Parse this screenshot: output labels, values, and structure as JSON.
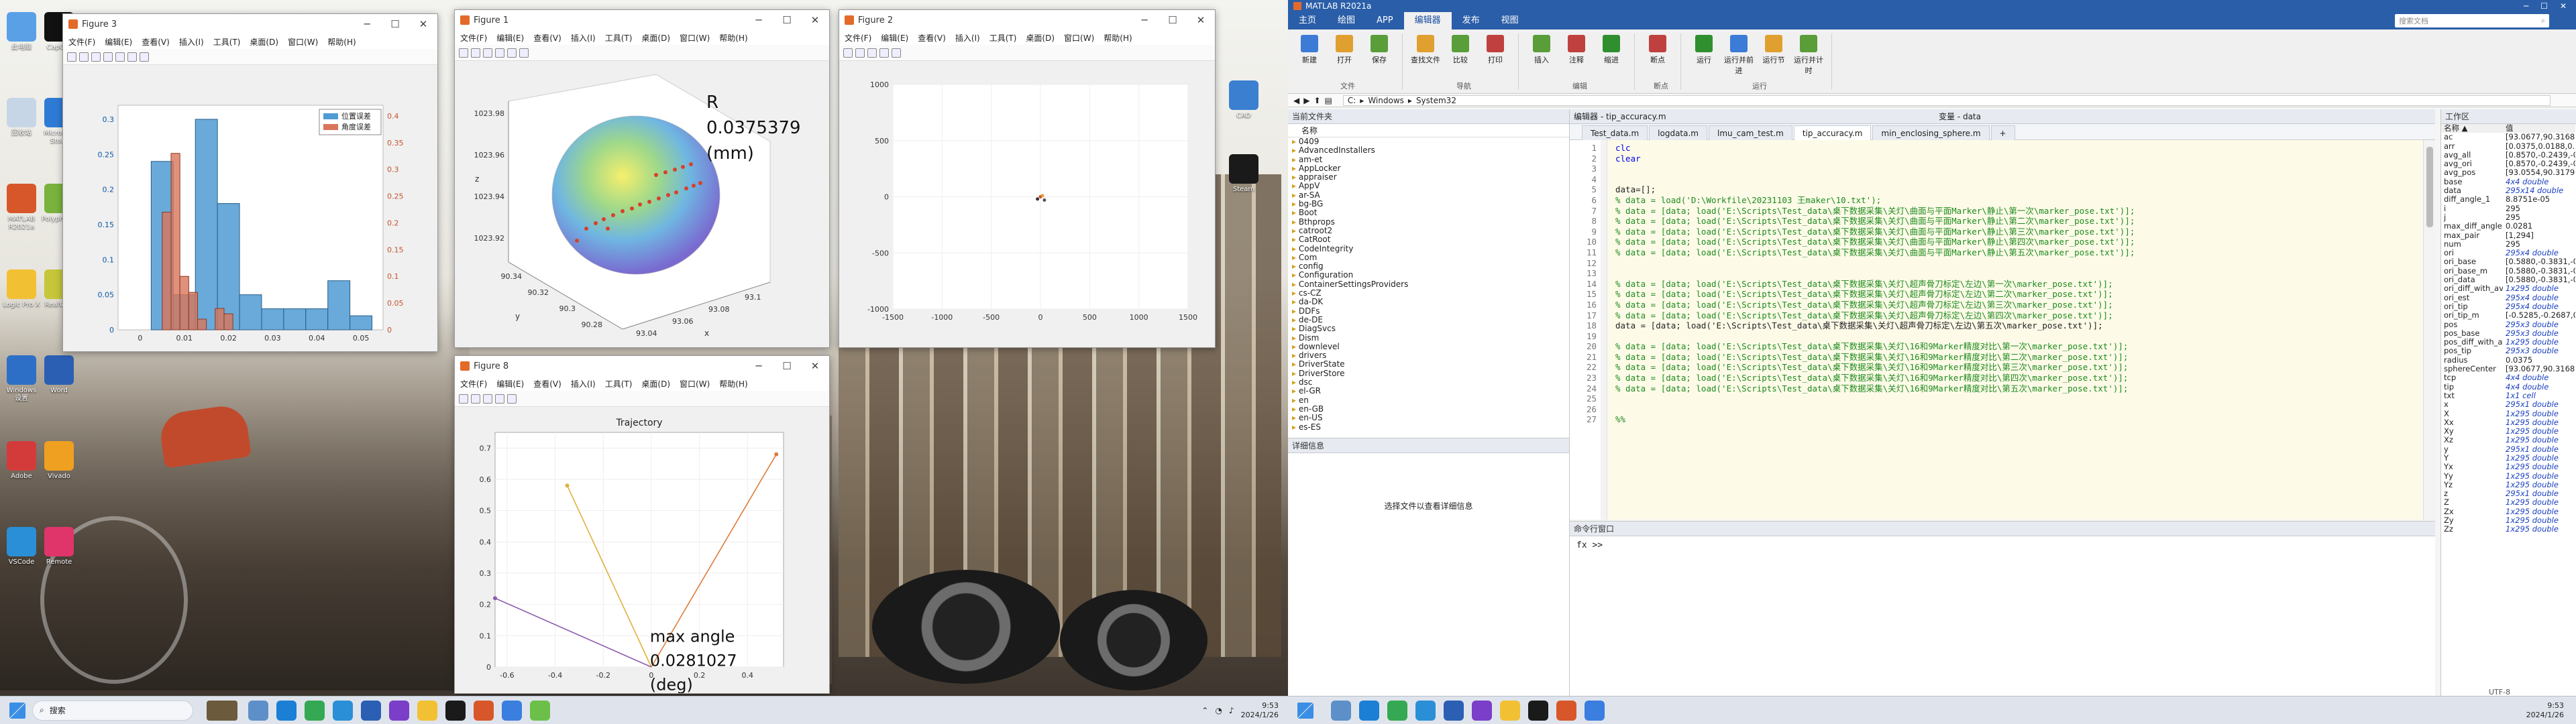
{
  "desktop": {
    "icons": [
      {
        "label": "此电脑",
        "color": "#5aa0e6"
      },
      {
        "label": "回收站",
        "color": "#c6d6e6"
      },
      {
        "label": "MATLAB R2021a",
        "color": "#d8572a"
      },
      {
        "label": "Logic Pro X",
        "color": "#f2c033"
      },
      {
        "label": "Windows 设置",
        "color": "#2d6fc7"
      },
      {
        "label": "Adobe",
        "color": "#d33b3b"
      },
      {
        "label": "VSCode",
        "color": "#2a8fd6"
      },
      {
        "label": "CapCut",
        "color": "#111111"
      },
      {
        "label": "Microsoft Store",
        "color": "#2e7bd6"
      },
      {
        "label": "Polyphone",
        "color": "#79b33d"
      },
      {
        "label": "RealVNC",
        "color": "#c6c63a"
      },
      {
        "label": "Word",
        "color": "#2b5fb4"
      },
      {
        "label": "Vivado",
        "color": "#f0a020"
      },
      {
        "label": "Remote",
        "color": "#e0356b"
      }
    ]
  },
  "taskbar": {
    "search": "搜索",
    "time": "9:53",
    "date": "2024/1/26",
    "time2": "9:53",
    "date2": "2024/1/26"
  },
  "fig3": {
    "title": "Figure 3",
    "menu": [
      "文件(F)",
      "编辑(E)",
      "查看(V)",
      "插入(I)",
      "工具(T)",
      "桌面(D)",
      "窗口(W)",
      "帮助(H)"
    ],
    "legend": [
      "位置误差",
      "角度误差"
    ],
    "legend_colors": [
      "#4f9bd4",
      "#d9765a"
    ],
    "chart_data": {
      "type": "bar",
      "x_ticks": [
        "0",
        "0.01",
        "0.02",
        "0.03",
        "0.04",
        "0.05"
      ],
      "y_left_ticks": [
        "0",
        "0.05",
        "0.1",
        "0.15",
        "0.2",
        "0.25",
        "0.3"
      ],
      "y_right_ticks": [
        "0",
        "0.05",
        "0.1",
        "0.15",
        "0.2",
        "0.25",
        "0.3",
        "0.35",
        "0.4"
      ],
      "series": [
        {
          "name": "位置误差",
          "bins": [
            [
              0.0025,
              0.0075,
              0.24
            ],
            [
              0.0075,
              0.0125,
              0.05
            ],
            [
              0.0125,
              0.0175,
              0.3
            ],
            [
              0.0175,
              0.0225,
              0.18
            ],
            [
              0.0225,
              0.0275,
              0.05
            ],
            [
              0.0275,
              0.0325,
              0.03
            ],
            [
              0.0325,
              0.0375,
              0.03
            ],
            [
              0.0375,
              0.0425,
              0.03
            ],
            [
              0.0425,
              0.0475,
              0.07
            ],
            [
              0.0475,
              0.0525,
              0.02
            ]
          ]
        },
        {
          "name": "角度误差",
          "bins": [
            [
              0.005,
              0.007,
              0.22
            ],
            [
              0.007,
              0.009,
              0.33
            ],
            [
              0.009,
              0.011,
              0.1
            ],
            [
              0.011,
              0.013,
              0.07
            ],
            [
              0.013,
              0.015,
              0.02
            ],
            [
              0.017,
              0.019,
              0.04
            ],
            [
              0.019,
              0.021,
              0.03
            ]
          ]
        }
      ]
    }
  },
  "fig1": {
    "title": "Figure 1",
    "menu": [
      "文件(F)",
      "编辑(E)",
      "查看(V)",
      "插入(I)",
      "工具(T)",
      "桌面(D)",
      "窗口(W)",
      "帮助(H)"
    ],
    "annot": [
      "R",
      "0.0375379",
      "(mm)"
    ],
    "chart_data": {
      "type": "scatter",
      "z_ticks": [
        "1023.92",
        "1023.94",
        "1023.96",
        "1023.98"
      ],
      "y_ticks": [
        "90.34",
        "90.32",
        "90.3",
        "90.28"
      ],
      "x_ticks": [
        "93.04",
        "93.06",
        "93.08",
        "93.1"
      ],
      "zlabel": "z",
      "ylabel": "y",
      "xlabel": "x"
    }
  },
  "fig2": {
    "title": "Figure 2",
    "menu": [
      "文件(F)",
      "编辑(E)",
      "查看(V)",
      "插入(I)",
      "工具(T)",
      "桌面(D)",
      "窗口(W)",
      "帮助(H)"
    ],
    "chart_data": {
      "type": "scatter",
      "x_ticks": [
        "-1500",
        "-1000",
        "-500",
        "0",
        "500",
        "1000",
        "1500"
      ],
      "y_ticks": [
        "1000",
        "500",
        "0",
        "-500",
        "-1000"
      ],
      "xlim": [
        -1500,
        1500
      ],
      "ylim": [
        -1000,
        1000
      ]
    }
  },
  "fig8": {
    "title": "Figure 8",
    "menu": [
      "文件(F)",
      "编辑(E)",
      "查看(V)",
      "插入(I)",
      "工具(T)",
      "桌面(D)",
      "窗口(W)",
      "帮助(H)"
    ],
    "annot": [
      "max angle",
      "0.0281027",
      "(deg)"
    ],
    "chart_data": {
      "type": "line",
      "title": "Trajectory",
      "x_ticks": [
        "-0.6",
        "-0.4",
        "-0.2",
        "0",
        "0.2",
        "0.4"
      ],
      "y_ticks": [
        "0",
        "0.1",
        "0.2",
        "0.3",
        "0.4",
        "0.5",
        "0.6",
        "0.7"
      ],
      "xlim": [
        -0.65,
        0.55
      ],
      "ylim": [
        0,
        0.75
      ],
      "series": [
        {
          "x": [
            0,
            0.52
          ],
          "y": [
            0,
            0.68
          ],
          "color": "#e07b3a"
        },
        {
          "x": [
            0,
            -0.35
          ],
          "y": [
            0,
            0.58
          ],
          "color": "#e0b040"
        },
        {
          "x": [
            0,
            -0.65
          ],
          "y": [
            0,
            0.22
          ],
          "color": "#8e5cae"
        }
      ]
    }
  },
  "matlab": {
    "title": "MATLAB R2021a",
    "tabs": [
      "主页",
      "绘图",
      "APP",
      "编辑器",
      "发布",
      "视图"
    ],
    "search_placeholder": "搜索文档",
    "ribbon_groups": [
      {
        "label": "文件",
        "buttons": [
          "新建",
          "打开",
          "保存"
        ]
      },
      {
        "label": "导航",
        "buttons": [
          "查找文件",
          "比较",
          "打印"
        ]
      },
      {
        "label": "编辑",
        "buttons": [
          "插入",
          "注释",
          "缩进"
        ]
      },
      {
        "label": "断点",
        "buttons": [
          "断点"
        ]
      },
      {
        "label": "运行",
        "buttons": [
          "运行",
          "运行并前进",
          "运行节",
          "运行并计时"
        ]
      }
    ],
    "path": [
      "C:",
      "Windows",
      "System32"
    ],
    "current_folder_title": "当前文件夹",
    "folder_col": "名称",
    "folders": [
      "0409",
      "AdvancedInstallers",
      "am-et",
      "AppLocker",
      "appraiser",
      "AppV",
      "ar-SA",
      "bg-BG",
      "Boot",
      "Bthprops",
      "catroot2",
      "CatRoot",
      "CodeIntegrity",
      "Com",
      "config",
      "Configuration",
      "ContainerSettingsProviders",
      "cs-CZ",
      "da-DK",
      "DDFs",
      "de-DE",
      "DiagSvcs",
      "Dism",
      "downlevel",
      "drivers",
      "DriverState",
      "DriverStore",
      "dsc",
      "el-GR",
      "en",
      "en-GB",
      "en-US",
      "es-ES"
    ],
    "details_title": "详细信息",
    "details_msg": "选择文件以查看详细信息",
    "editor_title": "编辑器 - tip_accuracy.m",
    "var_title": "变量 - data",
    "editor_tabs": [
      "Test_data.m",
      "logdata.m",
      "lmu_cam_test.m",
      "tip_accuracy.m",
      "min_enclosing_sphere.m"
    ],
    "active_tab": "tip_accuracy.m",
    "code": [
      {
        "t": "kw",
        "s": "clc"
      },
      {
        "t": "kw",
        "s": "clear"
      },
      {
        "t": "",
        "s": ""
      },
      {
        "t": "",
        "s": ""
      },
      {
        "t": "",
        "s": "data=[];"
      },
      {
        "t": "cm",
        "s": "% data = load('D:\\Workfile\\20231103 王maker\\10.txt');"
      },
      {
        "t": "cm",
        "s": "% data = [data; load('E:\\Scripts\\Test_data\\桌下数据采集\\关灯\\曲面与平面Marker\\静止\\第一次\\marker_pose.txt')];"
      },
      {
        "t": "cm",
        "s": "% data = [data; load('E:\\Scripts\\Test_data\\桌下数据采集\\关灯\\曲面与平面Marker\\静止\\第二次\\marker_pose.txt')];"
      },
      {
        "t": "cm",
        "s": "% data = [data; load('E:\\Scripts\\Test_data\\桌下数据采集\\关灯\\曲面与平面Marker\\静止\\第三次\\marker_pose.txt')];"
      },
      {
        "t": "cm",
        "s": "% data = [data; load('E:\\Scripts\\Test_data\\桌下数据采集\\关灯\\曲面与平面Marker\\静止\\第四次\\marker_pose.txt')];"
      },
      {
        "t": "cm",
        "s": "% data = [data; load('E:\\Scripts\\Test_data\\桌下数据采集\\关灯\\曲面与平面Marker\\静止\\第五次\\marker_pose.txt')];"
      },
      {
        "t": "",
        "s": ""
      },
      {
        "t": "",
        "s": ""
      },
      {
        "t": "cm",
        "s": "% data = [data; load('E:\\Scripts\\Test_data\\桌下数据采集\\关灯\\超声骨刀标定\\左边\\第一次\\marker_pose.txt')];"
      },
      {
        "t": "cm",
        "s": "% data = [data; load('E:\\Scripts\\Test_data\\桌下数据采集\\关灯\\超声骨刀标定\\左边\\第二次\\marker_pose.txt')];"
      },
      {
        "t": "cm",
        "s": "% data = [data; load('E:\\Scripts\\Test_data\\桌下数据采集\\关灯\\超声骨刀标定\\左边\\第三次\\marker_pose.txt')];"
      },
      {
        "t": "cm",
        "s": "% data = [data; load('E:\\Scripts\\Test_data\\桌下数据采集\\关灯\\超声骨刀标定\\左边\\第四次\\marker_pose.txt')];"
      },
      {
        "t": "",
        "s": "data = [data; load('E:\\Scripts\\Test_data\\桌下数据采集\\关灯\\超声骨刀标定\\左边\\第五次\\marker_pose.txt')];"
      },
      {
        "t": "",
        "s": ""
      },
      {
        "t": "cm",
        "s": "% data = [data; load('E:\\Scripts\\Test_data\\桌下数据采集\\关灯\\16和9Marker精度对比\\第一次\\marker_pose.txt')];"
      },
      {
        "t": "cm",
        "s": "% data = [data; load('E:\\Scripts\\Test_data\\桌下数据采集\\关灯\\16和9Marker精度对比\\第二次\\marker_pose.txt')];"
      },
      {
        "t": "cm",
        "s": "% data = [data; load('E:\\Scripts\\Test_data\\桌下数据采集\\关灯\\16和9Marker精度对比\\第三次\\marker_pose.txt')];"
      },
      {
        "t": "cm",
        "s": "% data = [data; load('E:\\Scripts\\Test_data\\桌下数据采集\\关灯\\16和9Marker精度对比\\第四次\\marker_pose.txt')];"
      },
      {
        "t": "cm",
        "s": "% data = [data; load('E:\\Scripts\\Test_data\\桌下数据采集\\关灯\\16和9Marker精度对比\\第五次\\marker_pose.txt')];"
      },
      {
        "t": "",
        "s": ""
      },
      {
        "t": "",
        "s": ""
      },
      {
        "t": "cm",
        "s": "%%"
      }
    ],
    "cmd_title": "命令行窗口",
    "cmd_prompt": "fx >>",
    "ws_title": "工作区",
    "ws_cols": [
      "名称 ▲",
      "值"
    ],
    "ws": [
      [
        "ac",
        "[93.0677,90.3168,1...",
        "n"
      ],
      [
        "arr",
        "[0.0375,0.0188,0.00...",
        "n"
      ],
      [
        "avg_all",
        "[0.8570,-0.2439,-0.3...",
        "n"
      ],
      [
        "avg_ori",
        "[0.8570,-0.2439,-0.3...",
        "n"
      ],
      [
        "avg_pos",
        "[93.0554,90.3179,1...",
        "n"
      ],
      [
        "base",
        "4x4 double",
        "i"
      ],
      [
        "data",
        "295x14 double",
        "i"
      ],
      [
        "diff_angle_1",
        "8.8751e-05",
        "n"
      ],
      [
        "i",
        "295",
        "n"
      ],
      [
        "j",
        "295",
        "n"
      ],
      [
        "max_diff_angle",
        "0.0281",
        "n"
      ],
      [
        "max_pair",
        "[1,294]",
        "n"
      ],
      [
        "num",
        "295",
        "n"
      ],
      [
        "ori",
        "295x4 double",
        "i"
      ],
      [
        "ori_base",
        "[0.5880,-0.3831,-0.7...",
        "n"
      ],
      [
        "ori_base_m",
        "[0.5880,-0.3831,-0.7...",
        "n"
      ],
      [
        "ori_data",
        "[0.5880,-0.3831,-0.7...",
        "n"
      ],
      [
        "ori_diff_with_avg",
        "1x295 double",
        "i"
      ],
      [
        "ori_est",
        "295x4 double",
        "i"
      ],
      [
        "ori_tip",
        "295x4 double",
        "i"
      ],
      [
        "ori_tip_m",
        "[-0.5285,-0.2687,0.8...",
        "n"
      ],
      [
        "pos",
        "295x3 double",
        "i"
      ],
      [
        "pos_base",
        "295x3 double",
        "i"
      ],
      [
        "pos_diff_with_avg",
        "1x295 double",
        "i"
      ],
      [
        "pos_tip",
        "295x3 double",
        "i"
      ],
      [
        "radius",
        "0.0375",
        "n"
      ],
      [
        "sphereCenter",
        "[93.0677,90.3168,1...",
        "n"
      ],
      [
        "tcp",
        "4x4 double",
        "i"
      ],
      [
        "tip",
        "4x4 double",
        "i"
      ],
      [
        "txt",
        "1x1 cell",
        "i"
      ],
      [
        "x",
        "295x1 double",
        "i"
      ],
      [
        "X",
        "1x295 double",
        "i"
      ],
      [
        "Xx",
        "1x295 double",
        "i"
      ],
      [
        "Xy",
        "1x295 double",
        "i"
      ],
      [
        "Xz",
        "1x295 double",
        "i"
      ],
      [
        "y",
        "295x1 double",
        "i"
      ],
      [
        "Y",
        "1x295 double",
        "i"
      ],
      [
        "Yx",
        "1x295 double",
        "i"
      ],
      [
        "Yy",
        "1x295 double",
        "i"
      ],
      [
        "Yz",
        "1x295 double",
        "i"
      ],
      [
        "z",
        "295x1 double",
        "i"
      ],
      [
        "Z",
        "1x295 double",
        "i"
      ],
      [
        "Zx",
        "1x295 double",
        "i"
      ],
      [
        "Zy",
        "1x295 double",
        "i"
      ],
      [
        "Zz",
        "1x295 double",
        "i"
      ]
    ],
    "status": "UTF-8"
  }
}
